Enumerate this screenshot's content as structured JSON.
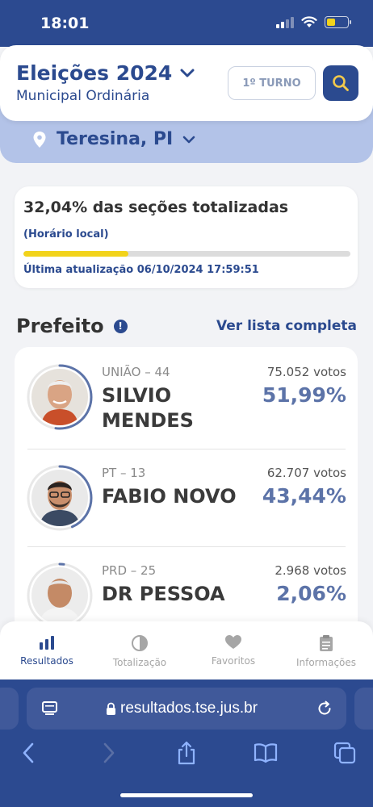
{
  "status_bar": {
    "time": "18:01"
  },
  "header": {
    "title": "Eleições 2024",
    "subtitle": "Municipal Ordinária",
    "turno_label": "1º TURNO",
    "location": "Teresina, PI"
  },
  "progress": {
    "title": "32,04% das seções totalizadas",
    "local_time_note": "(Horário local)",
    "fraction": 0.3204,
    "last_update": "Última atualização 06/10/2024 17:59:51"
  },
  "section": {
    "title": "Prefeito",
    "info_glyph": "!",
    "see_all_label": "Ver lista completa"
  },
  "candidates": [
    {
      "party": "UNIÃO – 44",
      "name": "SILVIO MENDES",
      "votes": "75.052 votos",
      "percent": "51,99%",
      "share": 0.5199
    },
    {
      "party": "PT – 13",
      "name": "FABIO NOVO",
      "votes": "62.707 votos",
      "percent": "43,44%",
      "share": 0.4344
    },
    {
      "party": "PRD – 25",
      "name": "DR PESSOA",
      "votes": "2.968 votos",
      "percent": "2,06%",
      "share": 0.0206
    }
  ],
  "tabs": [
    {
      "label": "Resultados",
      "icon": "bar-chart-icon",
      "active": true
    },
    {
      "label": "Totalização",
      "icon": "pie-chart-icon",
      "active": false
    },
    {
      "label": "Favoritos",
      "icon": "heart-icon",
      "active": false
    },
    {
      "label": "Informações",
      "icon": "clipboard-icon",
      "active": false
    }
  ],
  "browser": {
    "url": "resultados.tse.jus.br"
  },
  "colors": {
    "brand_blue": "#2b4a8f",
    "progress_yellow": "#f2d31b",
    "percent_blue": "#5c73a8",
    "ring_blue": "#5c73a8"
  }
}
